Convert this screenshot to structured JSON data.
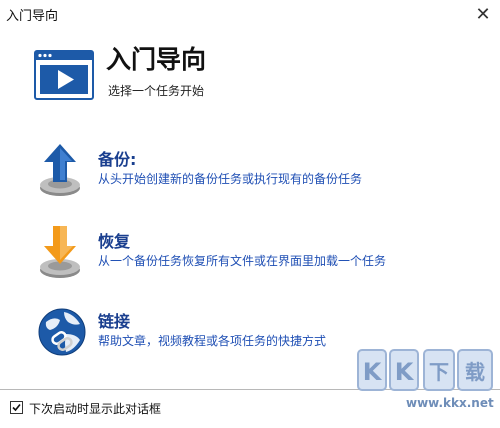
{
  "window": {
    "title": "入门导向",
    "close_glyph": "✕"
  },
  "header": {
    "title": "入门导向",
    "subtitle": "选择一个任务开始",
    "icon": "video-window-icon"
  },
  "options": [
    {
      "label": "备份:",
      "desc": "从头开始创建新的备份任务或执行现有的备份任务",
      "icon": "backup-upload-icon"
    },
    {
      "label": "恢复",
      "desc": "从一个备份任务恢复所有文件或在界面里加载一个任务",
      "icon": "restore-download-icon"
    },
    {
      "label": "链接",
      "desc": "帮助文章，视频教程或各项任务的快捷方式",
      "icon": "globe-link-icon"
    }
  ],
  "footer": {
    "checkbox_label": "下次启动时显示此对话框",
    "checked": true
  },
  "watermark": {
    "logo_text": "KK下载",
    "url": "www.kkx.net"
  },
  "colors": {
    "accent_blue": "#1f4fb4",
    "header_blue": "#1d5aa8",
    "arrow_orange": "#f39a1a"
  }
}
